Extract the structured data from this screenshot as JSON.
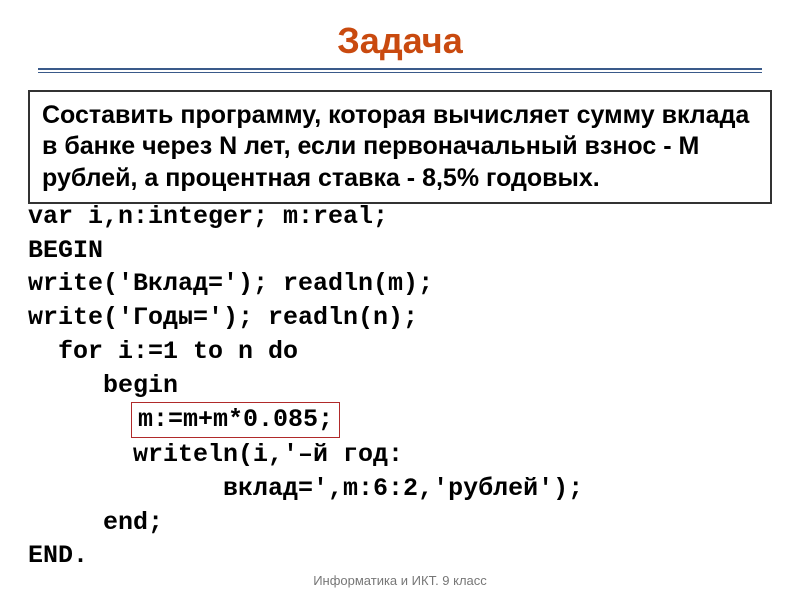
{
  "title": "Задача",
  "problem": "Составить программу, которая вычисляет сумму вклада в банке через N лет, если первоначальный взнос - M рублей, а процентная ставка - 8,5% годовых.",
  "code": {
    "l1": "var i,n:integer; m:real;",
    "l2": "BEGIN",
    "l3": "write('Вклад='); readln(m);",
    "l4": "write('Годы='); readln(n);",
    "l5": "  for i:=1 to n do",
    "l6": "     begin",
    "l7_indent": "       ",
    "l7": "m:=m+m*0.085;",
    "l8": "       writeln(i,'–й год:",
    "l9": "             вклад=',m:6:2,'рублей');",
    "l10": "     end;",
    "l11": "END."
  },
  "footer": "Информатика и ИКТ. 9 класс"
}
